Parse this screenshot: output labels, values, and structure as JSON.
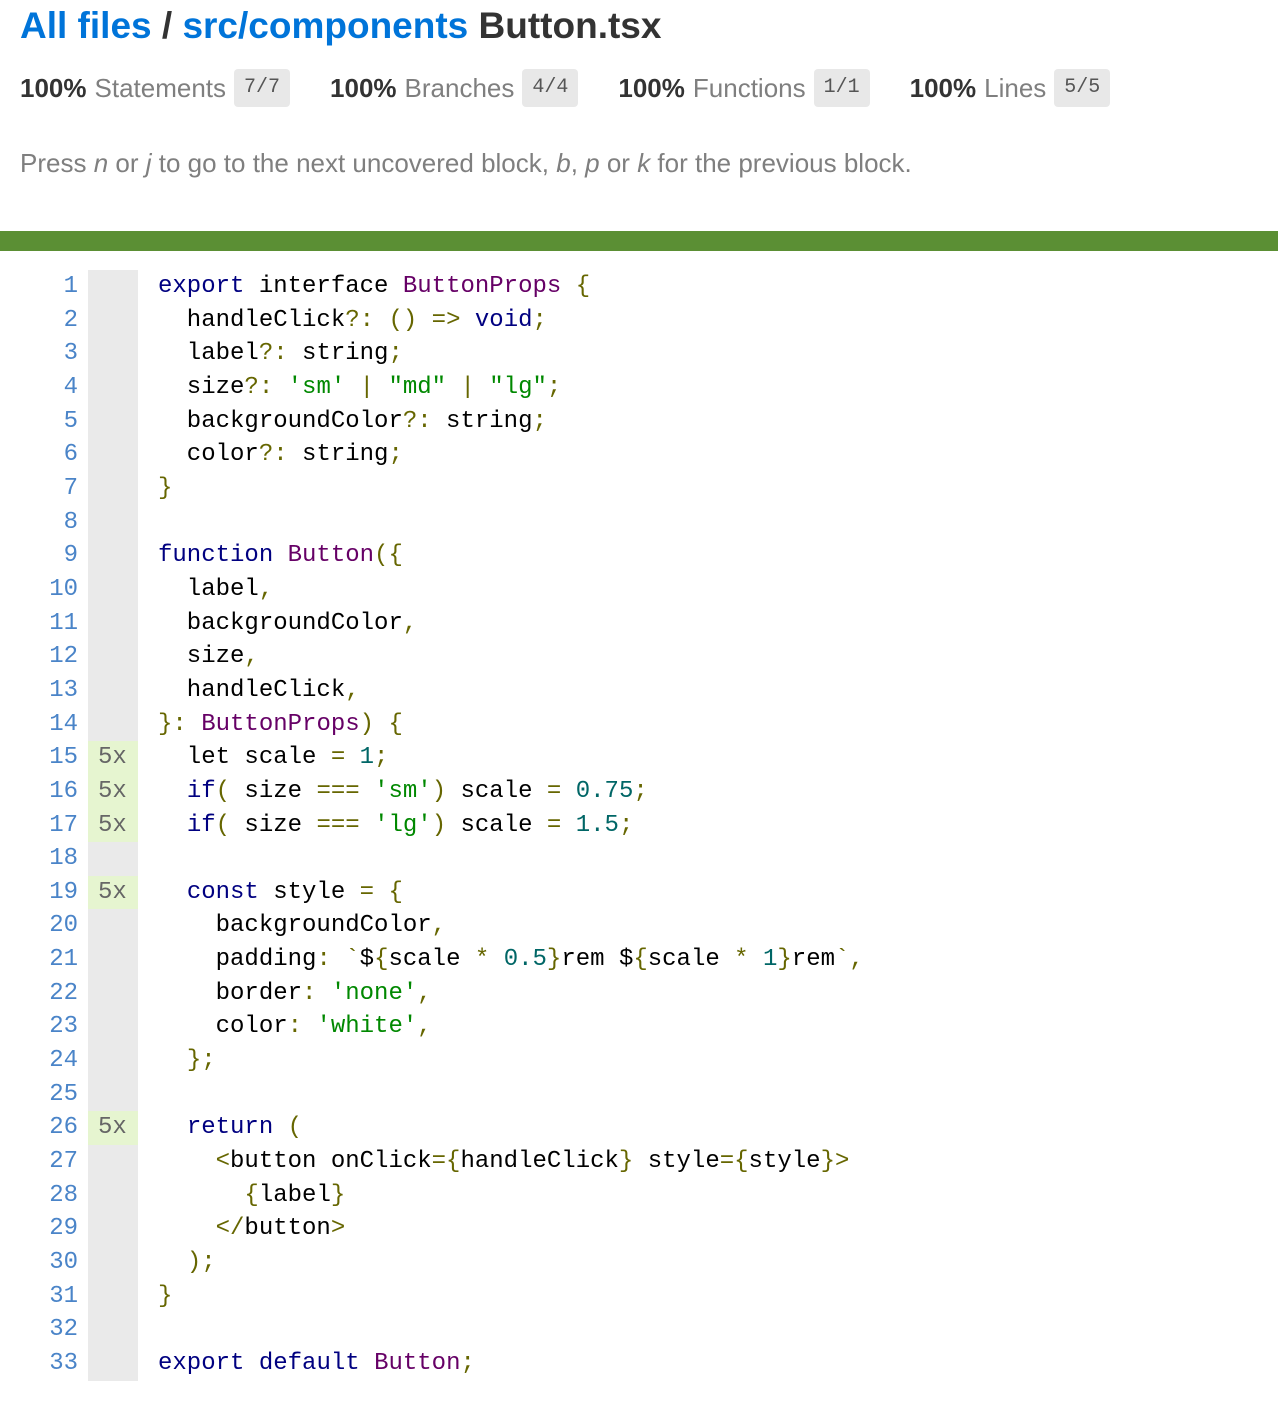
{
  "breadcrumb": {
    "root": "All files",
    "separator": "/",
    "folder": "src/components",
    "file": "Button.tsx"
  },
  "stats": [
    {
      "pct": "100%",
      "label": "Statements",
      "fraction": "7/7"
    },
    {
      "pct": "100%",
      "label": "Branches",
      "fraction": "4/4"
    },
    {
      "pct": "100%",
      "label": "Functions",
      "fraction": "1/1"
    },
    {
      "pct": "100%",
      "label": "Lines",
      "fraction": "5/5"
    }
  ],
  "help": {
    "t1": "Press ",
    "k1": "n",
    "t2": " or ",
    "k2": "j",
    "t3": " to go to the next uncovered block, ",
    "k3": "b",
    "t4": ", ",
    "k4": "p",
    "t5": " or ",
    "k5": "k",
    "t6": " for the previous block."
  },
  "colors": {
    "status_bar": "#5b8f34",
    "link": "#0074d9",
    "covered_line_bg": "#e6f5d0"
  },
  "code": {
    "lines": [
      {
        "n": "1",
        "hits": "",
        "tokens": [
          [
            "kw",
            "export"
          ],
          [
            "p",
            " "
          ],
          [
            "p",
            "interface"
          ],
          [
            "p",
            " "
          ],
          [
            "ty",
            "ButtonProps"
          ],
          [
            "p",
            " "
          ],
          [
            "pun",
            "{"
          ]
        ]
      },
      {
        "n": "2",
        "hits": "",
        "tokens": [
          [
            "p",
            "  handleClick"
          ],
          [
            "pun",
            "?:"
          ],
          [
            "p",
            " "
          ],
          [
            "pun",
            "()"
          ],
          [
            "p",
            " "
          ],
          [
            "pun",
            "=>"
          ],
          [
            "p",
            " "
          ],
          [
            "kw",
            "void"
          ],
          [
            "pun",
            ";"
          ]
        ]
      },
      {
        "n": "3",
        "hits": "",
        "tokens": [
          [
            "p",
            "  label"
          ],
          [
            "pun",
            "?:"
          ],
          [
            "p",
            " string"
          ],
          [
            "pun",
            ";"
          ]
        ]
      },
      {
        "n": "4",
        "hits": "",
        "tokens": [
          [
            "p",
            "  size"
          ],
          [
            "pun",
            "?:"
          ],
          [
            "p",
            " "
          ],
          [
            "str",
            "'sm'"
          ],
          [
            "p",
            " "
          ],
          [
            "pun",
            "|"
          ],
          [
            "p",
            " "
          ],
          [
            "str",
            "\"md\""
          ],
          [
            "p",
            " "
          ],
          [
            "pun",
            "|"
          ],
          [
            "p",
            " "
          ],
          [
            "str",
            "\"lg\""
          ],
          [
            "pun",
            ";"
          ]
        ]
      },
      {
        "n": "5",
        "hits": "",
        "tokens": [
          [
            "p",
            "  backgroundColor"
          ],
          [
            "pun",
            "?:"
          ],
          [
            "p",
            " string"
          ],
          [
            "pun",
            ";"
          ]
        ]
      },
      {
        "n": "6",
        "hits": "",
        "tokens": [
          [
            "p",
            "  color"
          ],
          [
            "pun",
            "?:"
          ],
          [
            "p",
            " string"
          ],
          [
            "pun",
            ";"
          ]
        ]
      },
      {
        "n": "7",
        "hits": "",
        "tokens": [
          [
            "pun",
            "}"
          ]
        ]
      },
      {
        "n": "8",
        "hits": "",
        "tokens": []
      },
      {
        "n": "9",
        "hits": "",
        "tokens": [
          [
            "kw",
            "function"
          ],
          [
            "p",
            " "
          ],
          [
            "ty",
            "Button"
          ],
          [
            "pun",
            "({"
          ]
        ]
      },
      {
        "n": "10",
        "hits": "",
        "tokens": [
          [
            "p",
            "  label"
          ],
          [
            "pun",
            ","
          ]
        ]
      },
      {
        "n": "11",
        "hits": "",
        "tokens": [
          [
            "p",
            "  backgroundColor"
          ],
          [
            "pun",
            ","
          ]
        ]
      },
      {
        "n": "12",
        "hits": "",
        "tokens": [
          [
            "p",
            "  size"
          ],
          [
            "pun",
            ","
          ]
        ]
      },
      {
        "n": "13",
        "hits": "",
        "tokens": [
          [
            "p",
            "  handleClick"
          ],
          [
            "pun",
            ","
          ]
        ]
      },
      {
        "n": "14",
        "hits": "",
        "tokens": [
          [
            "pun",
            "}:"
          ],
          [
            "p",
            " "
          ],
          [
            "ty",
            "ButtonProps"
          ],
          [
            "pun",
            ")"
          ],
          [
            "p",
            " "
          ],
          [
            "pun",
            "{"
          ]
        ]
      },
      {
        "n": "15",
        "hits": "5x",
        "tokens": [
          [
            "p",
            "  let scale "
          ],
          [
            "pun",
            "="
          ],
          [
            "p",
            " "
          ],
          [
            "num",
            "1"
          ],
          [
            "pun",
            ";"
          ]
        ]
      },
      {
        "n": "16",
        "hits": "5x",
        "tokens": [
          [
            "p",
            "  "
          ],
          [
            "kw",
            "if"
          ],
          [
            "pun",
            "("
          ],
          [
            "p",
            " size "
          ],
          [
            "pun",
            "==="
          ],
          [
            "p",
            " "
          ],
          [
            "str",
            "'sm'"
          ],
          [
            "pun",
            ")"
          ],
          [
            "p",
            " scale "
          ],
          [
            "pun",
            "="
          ],
          [
            "p",
            " "
          ],
          [
            "num",
            "0.75"
          ],
          [
            "pun",
            ";"
          ]
        ]
      },
      {
        "n": "17",
        "hits": "5x",
        "tokens": [
          [
            "p",
            "  "
          ],
          [
            "kw",
            "if"
          ],
          [
            "pun",
            "("
          ],
          [
            "p",
            " size "
          ],
          [
            "pun",
            "==="
          ],
          [
            "p",
            " "
          ],
          [
            "str",
            "'lg'"
          ],
          [
            "pun",
            ")"
          ],
          [
            "p",
            " scale "
          ],
          [
            "pun",
            "="
          ],
          [
            "p",
            " "
          ],
          [
            "num",
            "1.5"
          ],
          [
            "pun",
            ";"
          ]
        ]
      },
      {
        "n": "18",
        "hits": "",
        "tokens": []
      },
      {
        "n": "19",
        "hits": "5x",
        "tokens": [
          [
            "p",
            "  "
          ],
          [
            "kw",
            "const"
          ],
          [
            "p",
            " style "
          ],
          [
            "pun",
            "="
          ],
          [
            "p",
            " "
          ],
          [
            "pun",
            "{"
          ]
        ]
      },
      {
        "n": "20",
        "hits": "",
        "tokens": [
          [
            "p",
            "    backgroundColor"
          ],
          [
            "pun",
            ","
          ]
        ]
      },
      {
        "n": "21",
        "hits": "",
        "tokens": [
          [
            "p",
            "    padding"
          ],
          [
            "pun",
            ":"
          ],
          [
            "p",
            " "
          ],
          [
            "pun",
            "`"
          ],
          [
            "p",
            "$"
          ],
          [
            "pun",
            "{"
          ],
          [
            "p",
            "scale "
          ],
          [
            "pun",
            "*"
          ],
          [
            "p",
            " "
          ],
          [
            "num",
            "0.5"
          ],
          [
            "pun",
            "}"
          ],
          [
            "p",
            "rem $"
          ],
          [
            "pun",
            "{"
          ],
          [
            "p",
            "scale "
          ],
          [
            "pun",
            "*"
          ],
          [
            "p",
            " "
          ],
          [
            "num",
            "1"
          ],
          [
            "pun",
            "}"
          ],
          [
            "p",
            "rem"
          ],
          [
            "pun",
            "`,"
          ]
        ]
      },
      {
        "n": "22",
        "hits": "",
        "tokens": [
          [
            "p",
            "    border"
          ],
          [
            "pun",
            ":"
          ],
          [
            "p",
            " "
          ],
          [
            "str",
            "'none'"
          ],
          [
            "pun",
            ","
          ]
        ]
      },
      {
        "n": "23",
        "hits": "",
        "tokens": [
          [
            "p",
            "    color"
          ],
          [
            "pun",
            ":"
          ],
          [
            "p",
            " "
          ],
          [
            "str",
            "'white'"
          ],
          [
            "pun",
            ","
          ]
        ]
      },
      {
        "n": "24",
        "hits": "",
        "tokens": [
          [
            "p",
            "  "
          ],
          [
            "pun",
            "};"
          ]
        ]
      },
      {
        "n": "25",
        "hits": "",
        "tokens": []
      },
      {
        "n": "26",
        "hits": "5x",
        "tokens": [
          [
            "p",
            "  "
          ],
          [
            "kw",
            "return"
          ],
          [
            "p",
            " "
          ],
          [
            "pun",
            "("
          ]
        ]
      },
      {
        "n": "27",
        "hits": "",
        "tokens": [
          [
            "p",
            "    "
          ],
          [
            "pun",
            "<"
          ],
          [
            "p",
            "button onClick"
          ],
          [
            "pun",
            "={"
          ],
          [
            "p",
            "handleClick"
          ],
          [
            "pun",
            "}"
          ],
          [
            "p",
            " style"
          ],
          [
            "pun",
            "={"
          ],
          [
            "p",
            "style"
          ],
          [
            "pun",
            "}>"
          ]
        ]
      },
      {
        "n": "28",
        "hits": "",
        "tokens": [
          [
            "p",
            "      "
          ],
          [
            "pun",
            "{"
          ],
          [
            "p",
            "label"
          ],
          [
            "pun",
            "}"
          ]
        ]
      },
      {
        "n": "29",
        "hits": "",
        "tokens": [
          [
            "p",
            "    "
          ],
          [
            "pun",
            "</"
          ],
          [
            "p",
            "button"
          ],
          [
            "pun",
            ">"
          ]
        ]
      },
      {
        "n": "30",
        "hits": "",
        "tokens": [
          [
            "p",
            "  "
          ],
          [
            "pun",
            ");"
          ]
        ]
      },
      {
        "n": "31",
        "hits": "",
        "tokens": [
          [
            "pun",
            "}"
          ]
        ]
      },
      {
        "n": "32",
        "hits": "",
        "tokens": []
      },
      {
        "n": "33",
        "hits": "",
        "tokens": [
          [
            "kw",
            "export"
          ],
          [
            "p",
            " "
          ],
          [
            "kw",
            "default"
          ],
          [
            "p",
            " "
          ],
          [
            "ty",
            "Button"
          ],
          [
            "pun",
            ";"
          ]
        ]
      }
    ]
  }
}
